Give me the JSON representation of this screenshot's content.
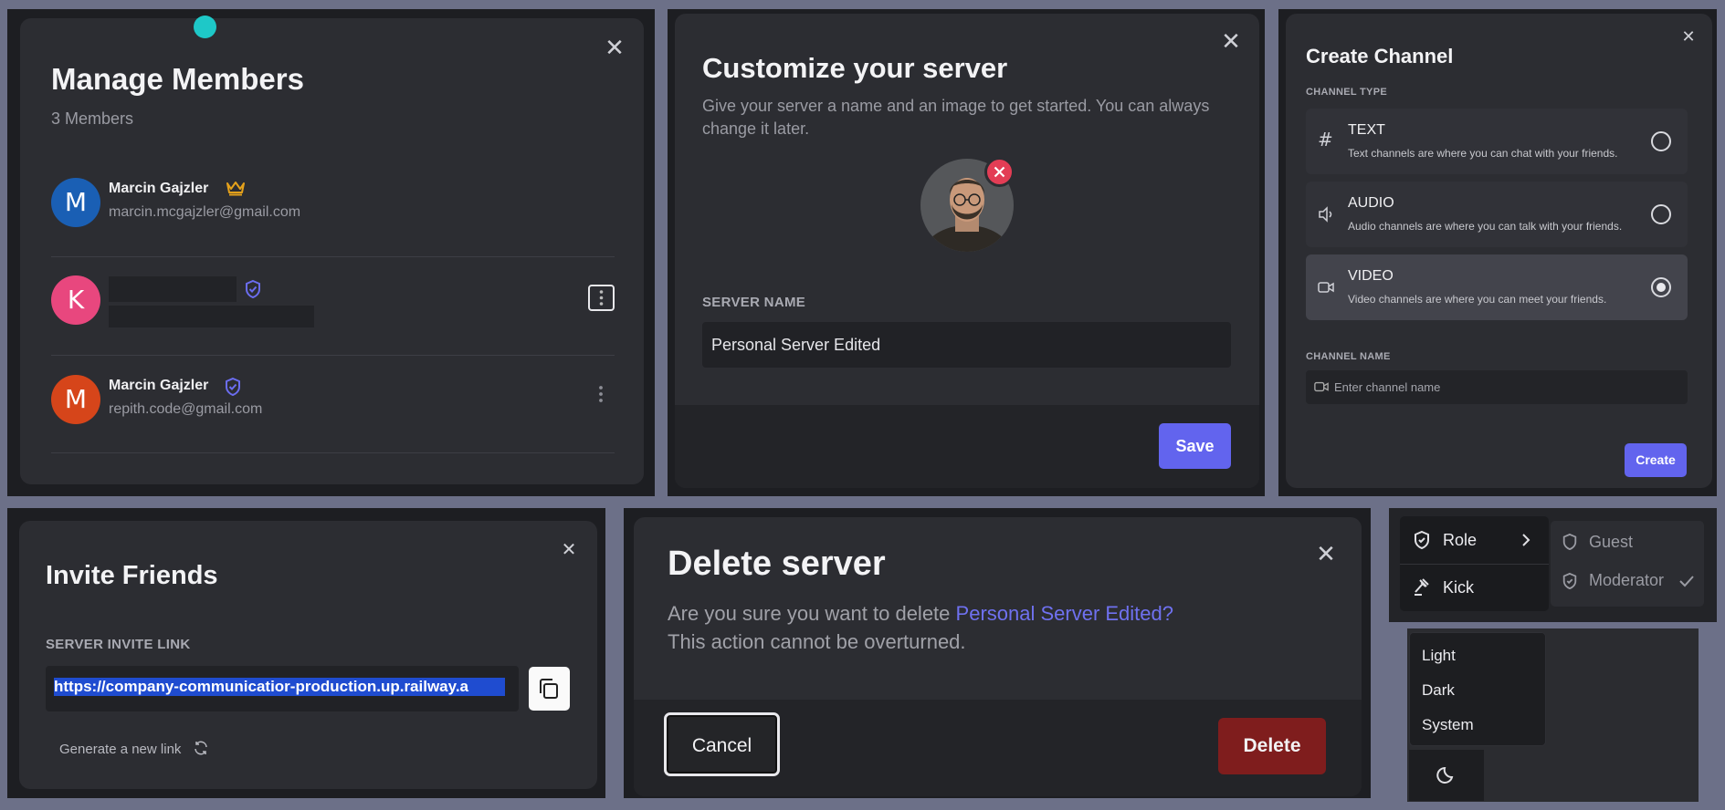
{
  "manage_members": {
    "title": "Manage Members",
    "subtitle": "3 Members",
    "members": [
      {
        "initial": "M",
        "name": "Marcin Gajzler",
        "email": "marcin.mcgajzler@gmail.com",
        "role_icon": "crown-icon",
        "avatar_color": "#1a5fb4"
      },
      {
        "initial": "K",
        "name": "",
        "email": "",
        "role_icon": "shield-check-icon",
        "avatar_color": "#e8477e"
      },
      {
        "initial": "M",
        "name": "Marcin Gajzler",
        "email": "repith.code@gmail.com",
        "role_icon": "shield-check-icon",
        "avatar_color": "#d6451a"
      }
    ]
  },
  "customize": {
    "title": "Customize your server",
    "description": "Give your server a name and an image to get started. You can always change it later.",
    "server_name_label": "SERVER NAME",
    "server_name_value": "Personal Server Edited",
    "save_label": "Save"
  },
  "create_channel": {
    "title": "Create Channel",
    "type_label": "CHANNEL TYPE",
    "options": [
      {
        "name": "TEXT",
        "desc": "Text channels are where you can chat with your friends.",
        "icon": "hash-icon",
        "selected": false
      },
      {
        "name": "AUDIO",
        "desc": "Audio channels are where you can talk with your friends.",
        "icon": "speaker-icon",
        "selected": false
      },
      {
        "name": "VIDEO",
        "desc": "Video channels are where you can meet your friends.",
        "icon": "video-icon",
        "selected": true
      }
    ],
    "name_label": "CHANNEL NAME",
    "name_placeholder": "Enter channel name",
    "create_label": "Create"
  },
  "invite": {
    "title": "Invite Friends",
    "link_label": "SERVER INVITE LINK",
    "link_value": "https://company-communicatior-production.up.railway.a",
    "generate_label": "Generate a new link"
  },
  "delete": {
    "title": "Delete server",
    "question": "Are you sure you want to delete ",
    "server_name": "Personal Server Edited?",
    "warning": "This action cannot be overturned.",
    "cancel_label": "Cancel",
    "delete_label": "Delete"
  },
  "role_menu": {
    "role_label": "Role",
    "kick_label": "Kick",
    "guest_label": "Guest",
    "moderator_label": "Moderator"
  },
  "theme_menu": {
    "options": [
      "Light",
      "Dark",
      "System"
    ]
  },
  "colors": {
    "accent": "#6264ee",
    "danger": "#7f1d1d",
    "cursor": "#1ec8c8"
  }
}
